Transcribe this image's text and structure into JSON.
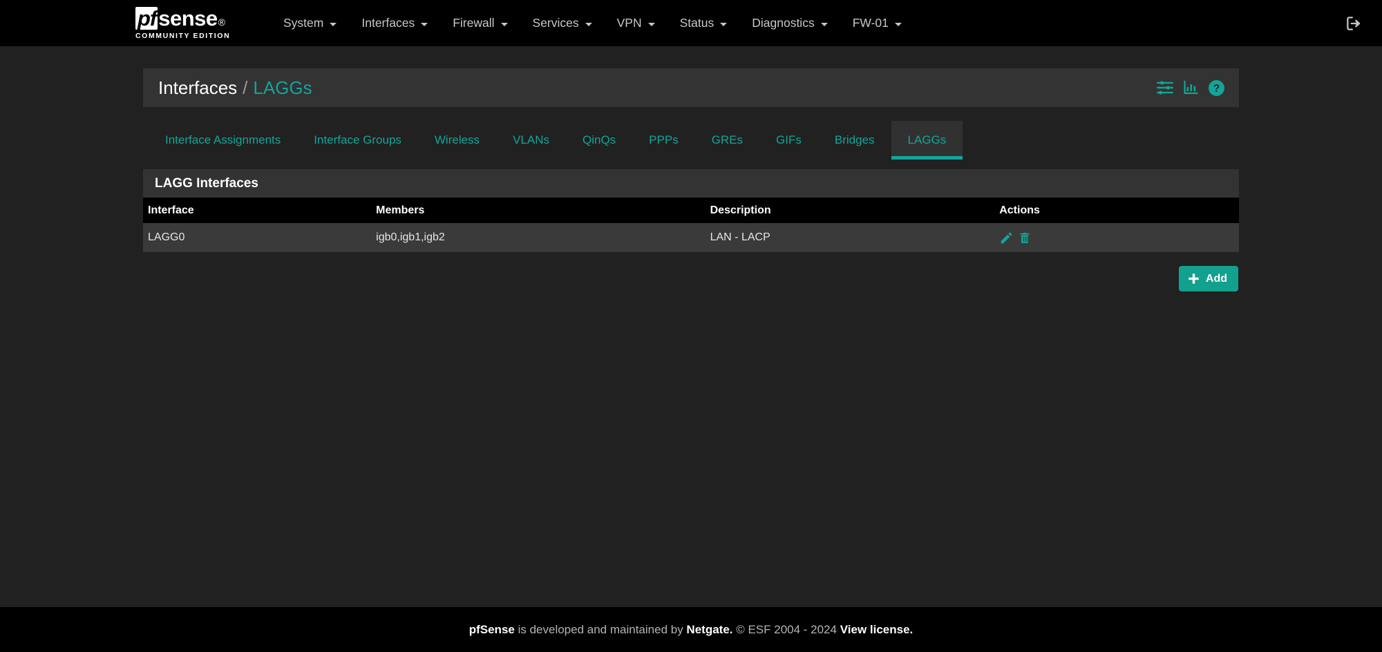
{
  "navbar": {
    "brand": {
      "pf": "pf",
      "sense": "sense",
      "subtitle": "COMMUNITY EDITION"
    },
    "menu": [
      {
        "label": "System",
        "has_caret": true
      },
      {
        "label": "Interfaces",
        "has_caret": true
      },
      {
        "label": "Firewall",
        "has_caret": true
      },
      {
        "label": "Services",
        "has_caret": true
      },
      {
        "label": "VPN",
        "has_caret": true
      },
      {
        "label": "Status",
        "has_caret": true
      },
      {
        "label": "Diagnostics",
        "has_caret": true
      },
      {
        "label": "FW-01",
        "has_caret": true
      }
    ],
    "logout_icon": "sign-out-icon"
  },
  "page_head": {
    "breadcrumb_parent": "Interfaces",
    "breadcrumb_separator": "/",
    "breadcrumb_current": "LAGGs",
    "icons": [
      {
        "name": "sliders-icon"
      },
      {
        "name": "bar-chart-icon"
      },
      {
        "name": "help-icon"
      }
    ]
  },
  "tabs": [
    {
      "label": "Interface Assignments",
      "active": false
    },
    {
      "label": "Interface Groups",
      "active": false
    },
    {
      "label": "Wireless",
      "active": false
    },
    {
      "label": "VLANs",
      "active": false
    },
    {
      "label": "QinQs",
      "active": false
    },
    {
      "label": "PPPs",
      "active": false
    },
    {
      "label": "GREs",
      "active": false
    },
    {
      "label": "GIFs",
      "active": false
    },
    {
      "label": "Bridges",
      "active": false
    },
    {
      "label": "LAGGs",
      "active": true
    }
  ],
  "panel": {
    "title": "LAGG Interfaces",
    "columns": [
      "Interface",
      "Members",
      "Description",
      "Actions"
    ],
    "rows": [
      {
        "interface": "LAGG0",
        "members": "igb0,igb1,igb2",
        "description": "LAN - LACP",
        "actions": [
          {
            "name": "edit-icon",
            "title": "Edit LAGG interface"
          },
          {
            "name": "delete-icon",
            "title": "Delete LAGG interface"
          }
        ]
      }
    ]
  },
  "add_button": {
    "label": "Add",
    "icon": "plus-icon"
  },
  "footer": {
    "part1": "pfSense",
    "part2": " is developed and maintained by ",
    "part3": "Netgate.",
    "part4": " © ESF 2004 - 2024 ",
    "part5": "View license."
  },
  "colors": {
    "accent": "#13a598",
    "button": "#12a08f",
    "page_bg": "#212121",
    "panel_bg": "#3a3a3a",
    "header_bg": "#333333",
    "navbar_bg": "#000000"
  }
}
